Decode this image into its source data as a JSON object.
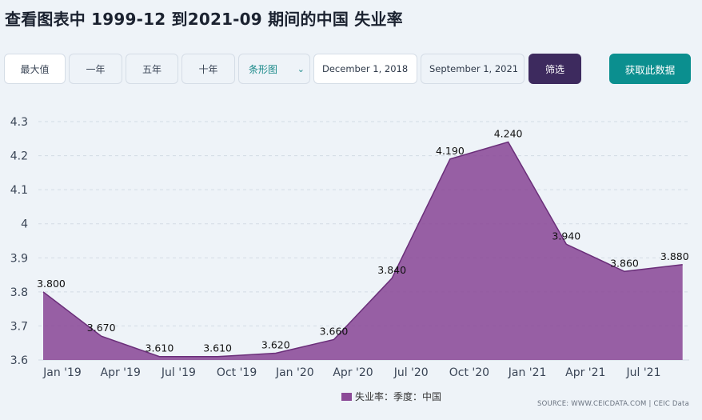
{
  "title": "查看图表中 1999-12 到2021-09 期间的中国 失业率",
  "toolbar": {
    "max_label": "最大值",
    "one_year_label": "一年",
    "five_year_label": "五年",
    "ten_year_label": "十年",
    "chart_type_label": "条形图",
    "start_date": "December 1, 2018",
    "end_date": "September 1, 2021",
    "filter_label": "筛选",
    "get_data_label": "获取此数据"
  },
  "legend": {
    "label": "失业率：季度：中国"
  },
  "source": "SOURCE: WWW.CEICDATA.COM | CEIC Data",
  "colors": {
    "area": "#8b4a97",
    "line": "#6b2f7a",
    "filter_button": "#3d2a5e",
    "get_data_button": "#0b8f8f"
  },
  "chart_data": {
    "type": "area",
    "x": [
      "2018-12",
      "2019-03",
      "2019-06",
      "2019-09",
      "2019-12",
      "2020-03",
      "2020-06",
      "2020-09",
      "2020-12",
      "2021-03",
      "2021-06",
      "2021-09"
    ],
    "series": [
      {
        "name": "失业率：季度：中国",
        "values": [
          3.8,
          3.67,
          3.61,
          3.61,
          3.62,
          3.66,
          3.84,
          4.19,
          4.24,
          3.94,
          3.86,
          3.88
        ],
        "labels": [
          "3.800",
          "3.670",
          "3.610",
          "3.610",
          "3.620",
          "3.660",
          "3.840",
          "4.190",
          "4.240",
          "3.940",
          "3.860",
          "3.880"
        ]
      }
    ],
    "y_ticks": [
      "3.6",
      "3.7",
      "3.8",
      "3.9",
      "4",
      "4.1",
      "4.2",
      "4.3"
    ],
    "x_ticks": [
      "Jan '19",
      "Apr '19",
      "Jul '19",
      "Oct '19",
      "Jan '20",
      "Apr '20",
      "Jul '20",
      "Oct '20",
      "Jan '21",
      "Apr '21",
      "Jul '21"
    ],
    "ylim": [
      3.6,
      4.3
    ],
    "grid": true,
    "legend_position": "bottom"
  }
}
